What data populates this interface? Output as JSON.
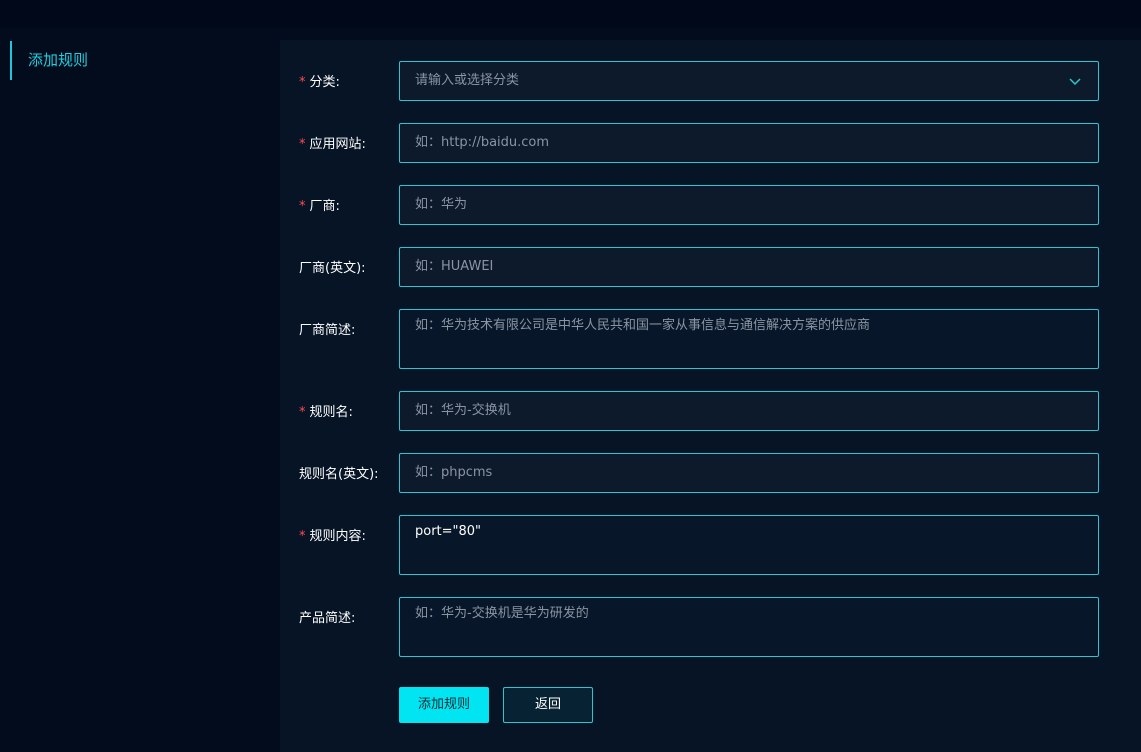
{
  "sidebar": {
    "items": [
      {
        "label": "添加规则"
      }
    ]
  },
  "form": {
    "required_mark": "*",
    "category": {
      "label": "分类:",
      "placeholder": "请输入或选择分类"
    },
    "website": {
      "label": "应用网站:",
      "placeholder": "如：http://baidu.com"
    },
    "vendor": {
      "label": "厂商:",
      "placeholder": "如：华为"
    },
    "vendor_en": {
      "label": "厂商(英文):",
      "placeholder": "如：HUAWEI"
    },
    "vendor_desc": {
      "label": "厂商简述:",
      "placeholder": "如：华为技术有限公司是中华人民共和国一家从事信息与通信解决方案的供应商"
    },
    "rule_name": {
      "label": "规则名:",
      "placeholder": "如：华为-交换机"
    },
    "rule_name_en": {
      "label": "规则名(英文):",
      "placeholder": "如：phpcms"
    },
    "rule_content": {
      "label": "规则内容:",
      "value": "port=\"80\""
    },
    "product_desc": {
      "label": "产品简述:",
      "placeholder": "如：华为-交换机是华为研发的"
    }
  },
  "buttons": {
    "submit": "添加规则",
    "back": "返回"
  },
  "colors": {
    "accent": "#00e5f1",
    "border": "#2ec5d3",
    "required": "#ff4d4f",
    "background": "#020c1d"
  },
  "icons": {
    "category_dropdown": "chevron-down-icon"
  }
}
